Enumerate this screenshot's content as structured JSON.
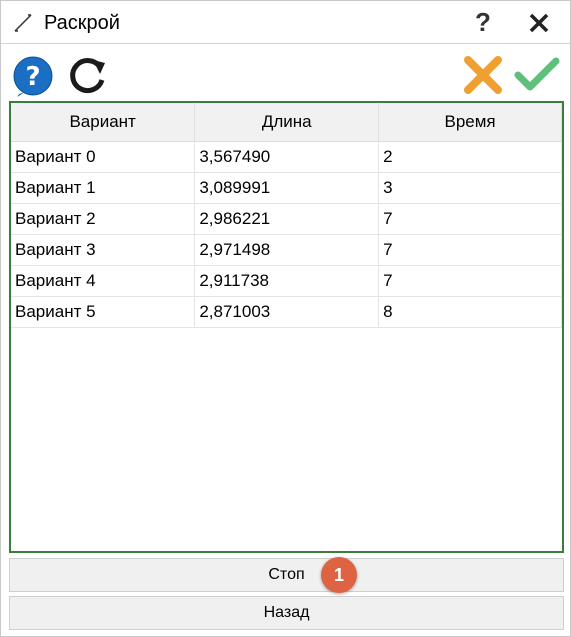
{
  "window": {
    "title": "Раскрой",
    "help_glyph": "?"
  },
  "icons": {
    "title": "tape-measure-icon",
    "help": "help-circle-icon",
    "refresh": "refresh-icon",
    "cancel": "cancel-x-icon",
    "ok": "checkmark-icon"
  },
  "colors": {
    "help_blue": "#1a6fc4",
    "cancel_orange": "#f0a030",
    "ok_green": "#5ec07a",
    "frame_green": "#3c7d3c",
    "badge_red": "#dd6342"
  },
  "table": {
    "columns": [
      "Вариант",
      "Длина",
      "Время"
    ],
    "rows": [
      [
        "Вариант 0",
        "3,567490",
        "2"
      ],
      [
        "Вариант 1",
        "3,089991",
        "3"
      ],
      [
        "Вариант 2",
        "2,986221",
        "7"
      ],
      [
        "Вариант 3",
        "2,971498",
        "7"
      ],
      [
        "Вариант 4",
        "2,911738",
        "7"
      ],
      [
        "Вариант 5",
        "2,871003",
        "8"
      ]
    ]
  },
  "buttons": {
    "stop": "Стоп",
    "back": "Назад"
  },
  "badge": "1"
}
